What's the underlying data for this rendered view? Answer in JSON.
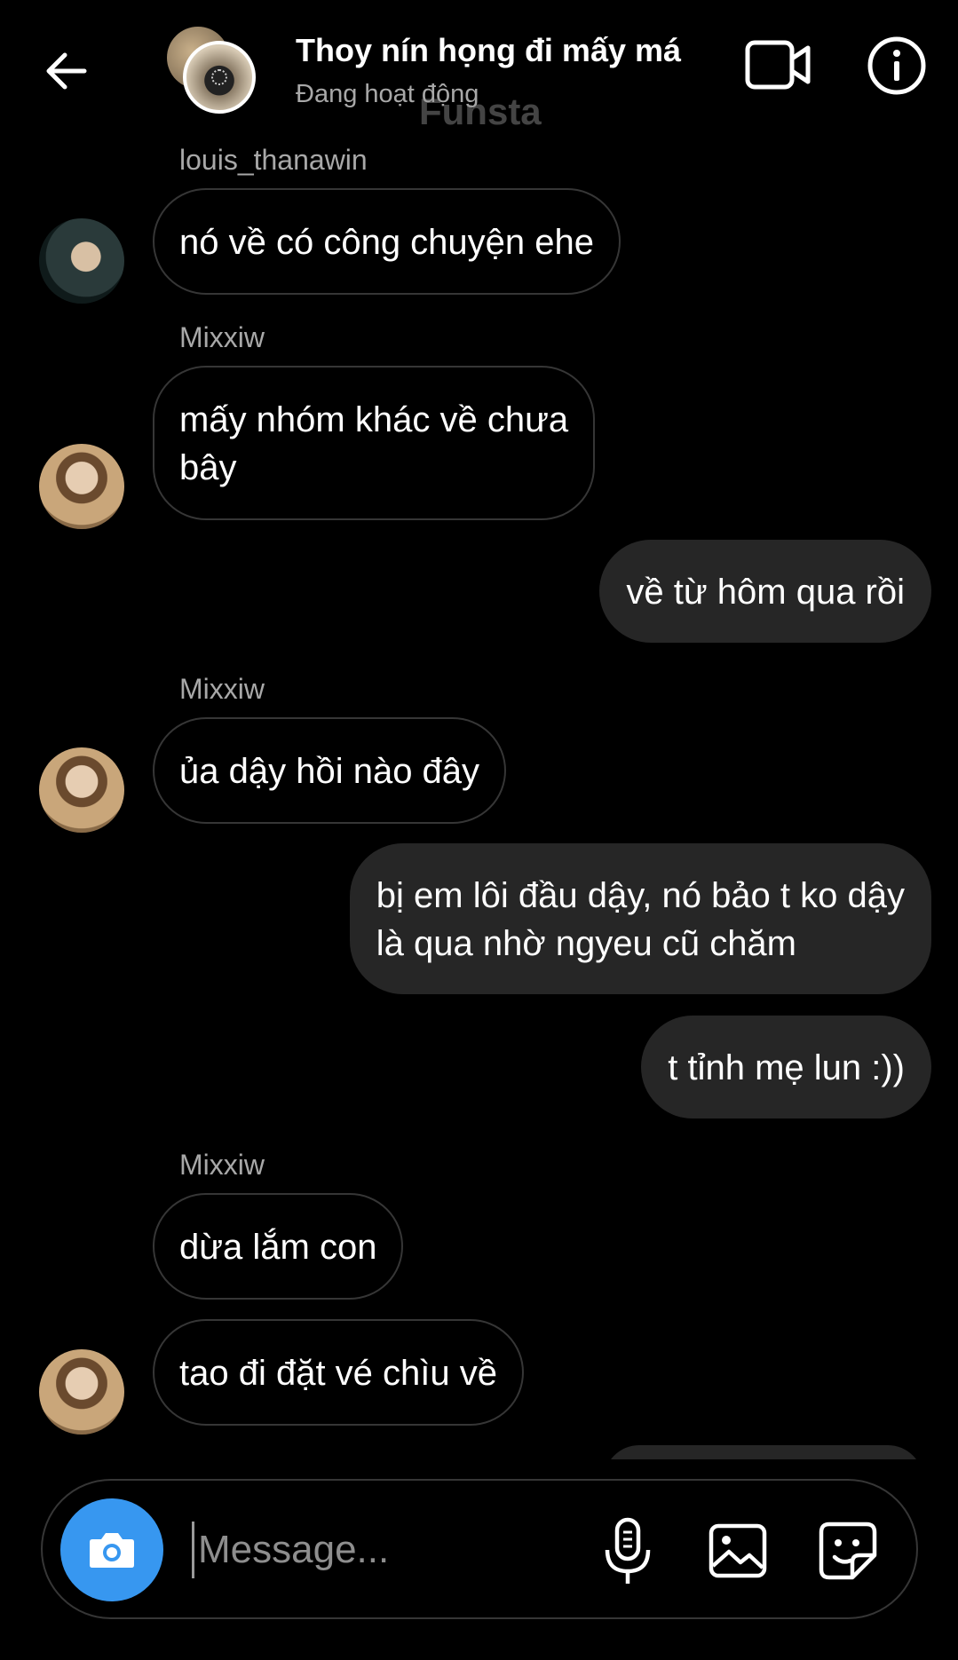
{
  "header": {
    "title": "Thoy nín họng đi mấy má",
    "status": "Đang hoạt động",
    "watermark": "Funsta",
    "icons": {
      "back": "arrow-left-icon",
      "video": "video-camera-icon",
      "info": "info-icon"
    }
  },
  "messages": [
    {
      "direction": "incoming",
      "sender": "louis_thanawin",
      "lines": [
        "nó về có công chuyện ehe"
      ]
    },
    {
      "direction": "incoming",
      "sender": "Mixxiw",
      "lines": [
        "mấy nhóm khác về chưa",
        "bây"
      ]
    },
    {
      "direction": "outgoing",
      "lines": [
        "về từ hôm qua rồi"
      ]
    },
    {
      "direction": "incoming",
      "sender": "Mixxiw",
      "lines": [
        "ủa dậy hồi nào đây"
      ]
    },
    {
      "direction": "outgoing",
      "lines": [
        "bị em lôi đầu dậy, nó bảo t ko dậy",
        "là qua nhờ ngyeu cũ chăm"
      ]
    },
    {
      "direction": "outgoing",
      "lines": [
        "t tỉnh mẹ lun :))"
      ]
    },
    {
      "direction": "incoming",
      "sender": "Mixxiw",
      "lines": [
        "dừa lắm con"
      ]
    },
    {
      "direction": "incoming",
      "lines": [
        "tao đi đặt vé chìu về"
      ]
    }
  ],
  "composer": {
    "placeholder": "Message...",
    "icons": {
      "camera": "camera-icon",
      "mic": "microphone-icon",
      "gallery": "image-icon",
      "sticker": "sticker-icon"
    }
  },
  "colors": {
    "background": "#000000",
    "outgoing_bubble": "#262626",
    "incoming_border": "#363636",
    "secondary_text": "#a8a8a8",
    "camera_button": "#3797f0"
  }
}
